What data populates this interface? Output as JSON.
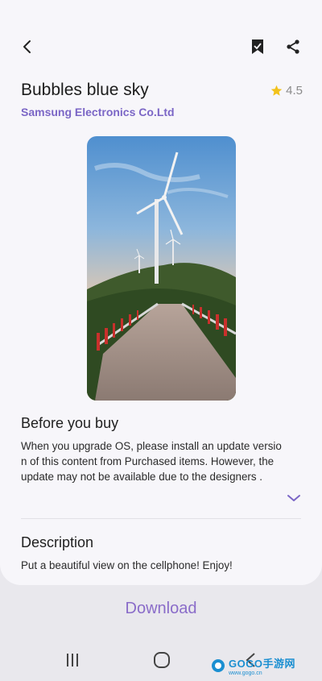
{
  "header": {
    "back_icon": "back-arrow-icon",
    "bookmark_icon": "bookmark-icon",
    "share_icon": "share-icon"
  },
  "product": {
    "title": "Bubbles blue sky",
    "publisher": "Samsung Electronics Co.Ltd",
    "rating": "4.5",
    "rating_icon": "star-icon",
    "accent_color": "#7b66c6",
    "star_color": "#f2c21b"
  },
  "before_you_buy": {
    "heading": "Before you buy",
    "lines": [
      "When you upgrade OS, please install an update versio",
      "n of this content from Purchased items. However, the",
      "update may not be available due to the designers ."
    ],
    "expand_icon": "chevron-down-icon"
  },
  "description": {
    "heading": "Description",
    "text": "Put a beautiful view on the cellphone! Enjoy!"
  },
  "actions": {
    "download_label": "Download"
  },
  "navbar": {
    "recents_icon": "recents-icon",
    "home_icon": "home-icon",
    "back_icon": "nav-back-icon"
  },
  "watermark": {
    "text": "GOGO手游网",
    "subtext": "www.gogo.cn"
  }
}
